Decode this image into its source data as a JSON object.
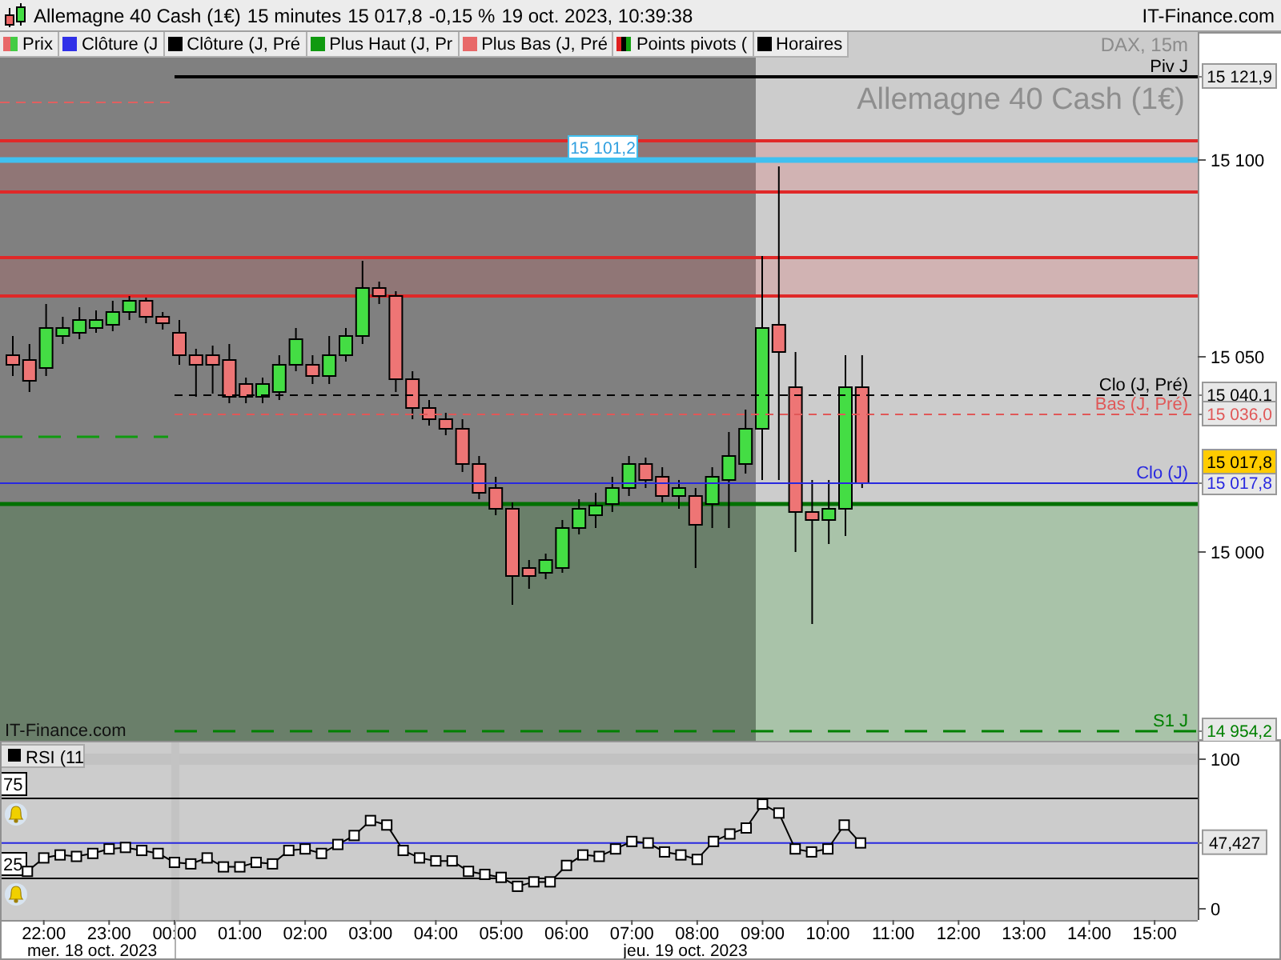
{
  "title_bar": {
    "instrument": "Allemagne 40 Cash (1€)",
    "interval": "15 minutes",
    "price": "15 017,8",
    "change": "-0,15 %",
    "timestamp": "19 oct. 2023, 10:39:38",
    "site": "IT-Finance.com"
  },
  "legend": [
    {
      "label": "Prix",
      "kind": "split"
    },
    {
      "label": "Clôture (J",
      "kind": "solid",
      "color": "#3030e8"
    },
    {
      "label": "Clôture (J, Pré",
      "kind": "solid",
      "color": "#000000"
    },
    {
      "label": "Plus Haut (J, Pr",
      "kind": "solid",
      "color": "#109a10"
    },
    {
      "label": "Plus Bas (J, Pré",
      "kind": "solid",
      "color": "#e86868"
    },
    {
      "label": "Points pivots (",
      "kind": "multi"
    },
    {
      "label": "Horaires",
      "kind": "solid",
      "color": "#000000"
    }
  ],
  "price_chart": {
    "subtitle": "DAX, 15m",
    "heading": "Allemagne 40 Cash (1€)",
    "credit": "IT-Finance.com",
    "cursor_tag": "15 101,2",
    "last_price_tag": "15 017,8",
    "levels": [
      {
        "kind": "pivot",
        "label": "Piv J",
        "tag": "15 121,9",
        "color": "#000000"
      },
      {
        "kind": "dashed",
        "label": "Clo (J, Pré)",
        "tag": "15 040,1",
        "color": "#000000"
      },
      {
        "kind": "dashed",
        "label": "Bas (J, Pré)",
        "tag": "15 036,0",
        "color": "#e05858"
      },
      {
        "kind": "solid",
        "label": "Clo (J)",
        "tag": "15 017,8",
        "color": "#2828e0"
      },
      {
        "kind": "longdash",
        "label": "S1 J",
        "tag": "14 954,2",
        "color": "#008000"
      }
    ],
    "axis_ticks": [
      "15 100",
      "15 050",
      "15 000"
    ]
  },
  "rsi": {
    "levels": [
      "75",
      "25"
    ],
    "current_tag": "47,427",
    "dates": [
      "mer. 18 oct. 2023",
      "jeu. 19 oct. 2023"
    ],
    "previous_day_time_labels": [
      "22:00",
      "23:00"
    ],
    "chart_data": {
      "type": "line",
      "x": [
        -2.25,
        -2,
        -1.75,
        -1.5,
        -1.25,
        -1,
        -0.75,
        -0.5,
        -0.25,
        0,
        0.25,
        0.5,
        0.75,
        1,
        1.25,
        1.5,
        1.75,
        2,
        2.25,
        2.5,
        2.75,
        3,
        3.25,
        3.5,
        3.75,
        4,
        4.25,
        4.5,
        4.75,
        5,
        5.25,
        5.5,
        5.75,
        6,
        6.25,
        6.5,
        6.75,
        7,
        7.25,
        7.5,
        7.75,
        8,
        8.25,
        8.5,
        8.75,
        9,
        9.25,
        9.5,
        9.75,
        10,
        10.25,
        10.5
      ],
      "series": [
        {
          "name": "RSI (11",
          "color": "#000000",
          "marker": "square",
          "values": [
            25,
            34,
            36,
            35,
            37,
            40,
            41,
            39,
            37,
            31,
            30,
            34,
            28,
            28,
            31,
            30,
            39,
            40,
            37,
            43,
            49,
            59,
            56,
            39,
            34,
            32,
            32,
            25,
            23,
            21,
            15,
            18,
            18,
            29,
            36,
            35,
            40,
            45,
            44,
            38,
            36,
            33,
            45,
            50,
            54,
            70,
            64,
            40,
            38,
            40,
            56,
            44
          ]
        }
      ],
      "xlim": [
        -2.67,
        15.66
      ],
      "ylim": [
        -7.5,
        112.3
      ],
      "yticks": [
        {
          "value": 0,
          "label": "0"
        },
        {
          "value": 100,
          "label": "100"
        }
      ],
      "xticks": [
        {
          "value": 0,
          "label": "00:00"
        },
        {
          "value": 1,
          "label": "01:00"
        },
        {
          "value": 2,
          "label": "02:00"
        },
        {
          "value": 3,
          "label": "03:00"
        },
        {
          "value": 4,
          "label": "04:00"
        },
        {
          "value": 5,
          "label": "05:00"
        },
        {
          "value": 6,
          "label": "06:00"
        },
        {
          "value": 7,
          "label": "07:00"
        },
        {
          "value": 8,
          "label": "08:00"
        },
        {
          "value": 9,
          "label": "09:00"
        },
        {
          "value": 10,
          "label": "10:00"
        },
        {
          "value": 11,
          "label": "11:00"
        },
        {
          "value": 12,
          "label": "12:00"
        },
        {
          "value": 13,
          "label": "13:00"
        },
        {
          "value": 14,
          "label": "14:00"
        },
        {
          "value": 15,
          "label": "15:00"
        }
      ]
    }
  }
}
